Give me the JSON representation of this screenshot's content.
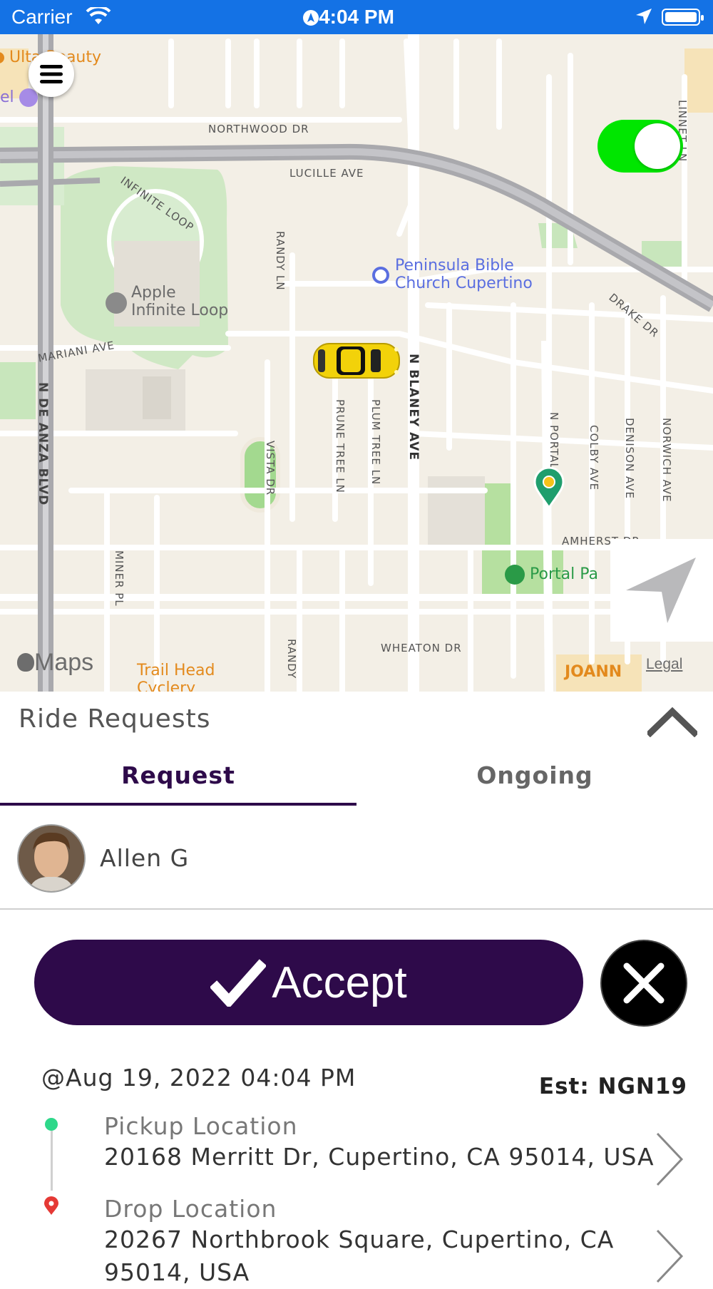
{
  "status_bar": {
    "carrier": "Carrier",
    "time": "4:04 PM"
  },
  "map": {
    "streets": {
      "northwood": "NORTHWOOD DR",
      "lucille": "LUCILLE AVE",
      "infinite_loop": "INFINITE LOOP",
      "randy_ln": "RANDY LN",
      "randy_ln_south": "RANDY",
      "mariani": "MARIANI AVE",
      "n_de_anza": "N DE ANZA BLVD",
      "vista": "VISTA DR",
      "prune_tree": "PRUNE TREE LN",
      "plum_tree": "PLUM TREE LN",
      "n_blaney": "N BLANEY AVE",
      "n_portal": "N PORTAL AVE",
      "colby": "COLBY AVE",
      "denison": "DENISON AVE",
      "norwich": "NORWICH AVE",
      "drake": "DRAKE DR",
      "linnet": "LINNET LN",
      "amherst": "AMHERST DR",
      "miner": "MINER PL",
      "wheaton": "WHEATON DR"
    },
    "pois": {
      "ulta": "Ulta Beauty",
      "hotel_fragment": "el",
      "peninsula_line1": "Peninsula Bible",
      "peninsula_line2": "Church Cupertino",
      "apple_line1": "Apple",
      "apple_line2": "Infinite Loop",
      "portal_park": "Portal Pa",
      "trail_head_line1": "Trail Head",
      "trail_head_line2": "Cyclery",
      "joann": "JOANN"
    },
    "attribution": {
      "logo": "Maps",
      "legal": "Legal"
    },
    "online_toggle": {
      "on": true
    },
    "colors": {
      "toggle_on": "#00e600",
      "poi_blue": "#5a6ee0",
      "poi_green": "#2a9a47",
      "poi_orange": "#e38a1d",
      "user_pin": "#1f9e6d"
    }
  },
  "sheet": {
    "title": "Ride Requests",
    "tabs": {
      "request": "Request",
      "ongoing": "Ongoing",
      "active": "request"
    },
    "request": {
      "rider_name": "Allen G",
      "accept_label": "Accept",
      "datetime": "@Aug 19, 2022 04:04 PM",
      "estimate": "Est: NGN19",
      "pickup": {
        "label": "Pickup Location",
        "address": "20168 Merritt Dr, Cupertino, CA 95014, USA"
      },
      "drop": {
        "label": "Drop Location",
        "address_line1": "20267 Northbrook Square, Cupertino, CA",
        "address_line2": "95014, USA"
      }
    },
    "colors": {
      "primary": "#2e0a4a",
      "pickup_dot": "#2ed88a",
      "drop_pin": "#e53935"
    }
  }
}
